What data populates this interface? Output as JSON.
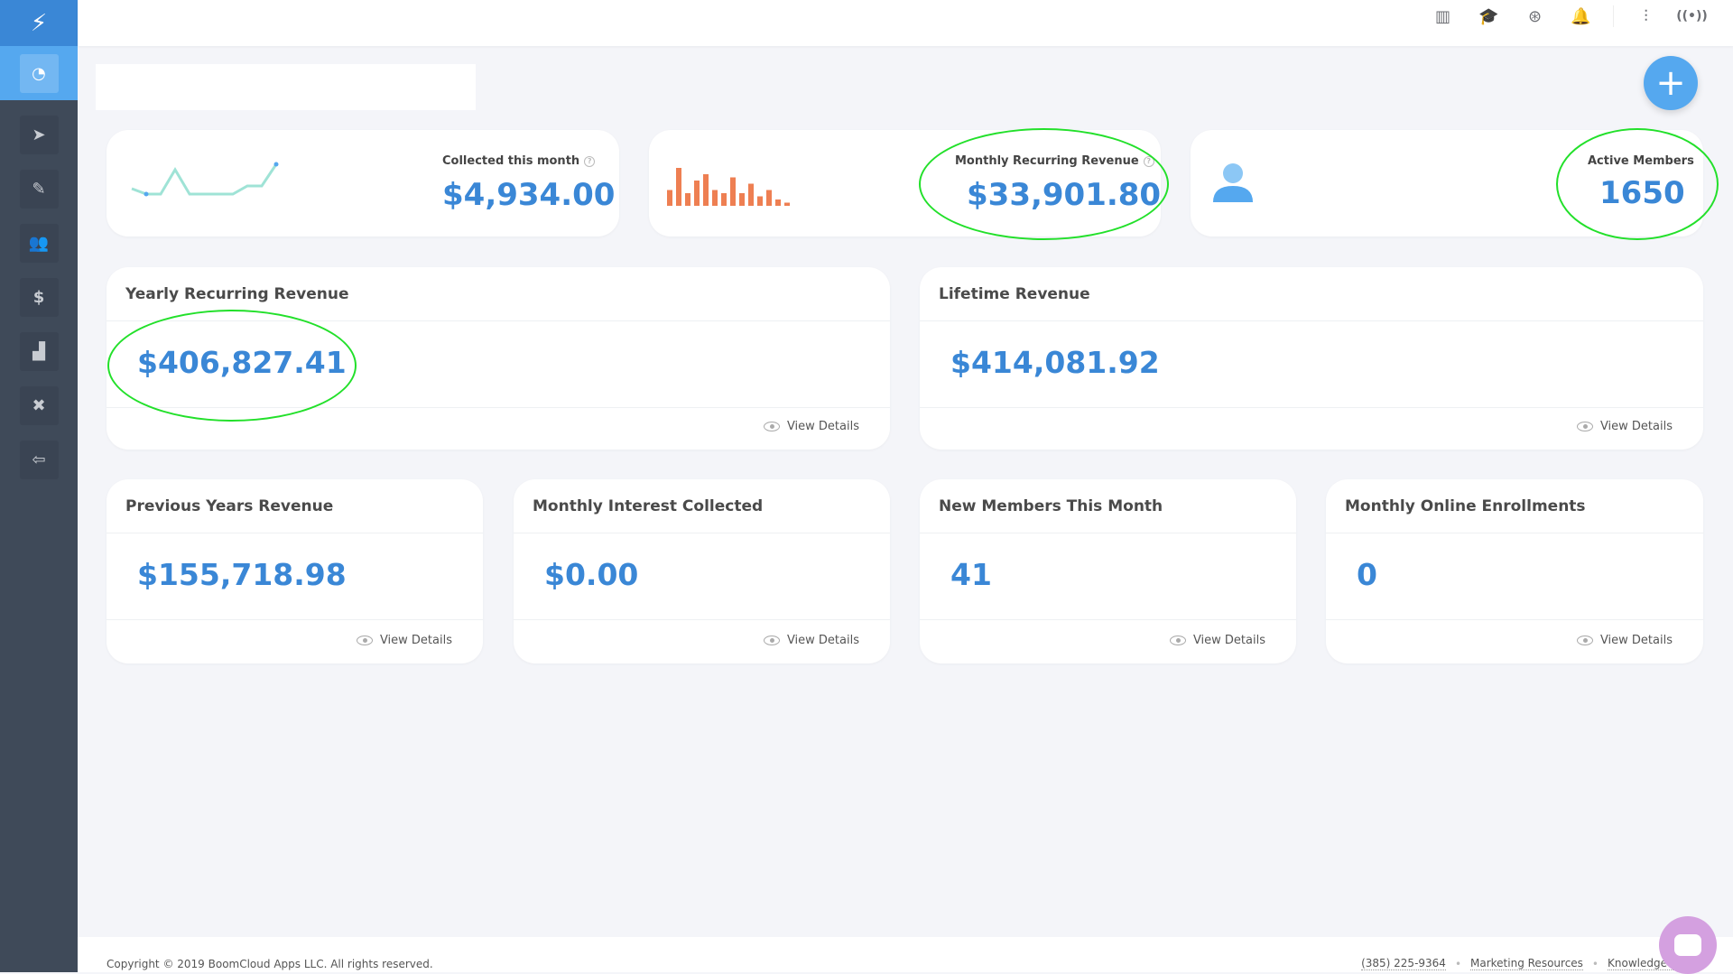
{
  "sidebar": {
    "logo": "bolt-icon",
    "items": [
      {
        "icon": "dashboard-icon",
        "active": true
      },
      {
        "icon": "navigation-icon"
      },
      {
        "icon": "check-sign-icon"
      },
      {
        "icon": "members-icon"
      },
      {
        "icon": "dollar-icon"
      },
      {
        "icon": "chart-icon"
      },
      {
        "icon": "tools-icon"
      },
      {
        "icon": "logout-icon"
      }
    ]
  },
  "topbar": {
    "icons": [
      "library-icon",
      "graduation-cap-icon",
      "lifebuoy-icon",
      "bell-icon",
      "sliders-icon",
      "broadcast-icon"
    ]
  },
  "search": {
    "value": ""
  },
  "fab": {
    "label": "+"
  },
  "kpis": {
    "collected": {
      "label": "Collected this month",
      "value": "$4,934.00"
    },
    "mrr": {
      "label": "Monthly Recurring Revenue",
      "value": "$33,901.80"
    },
    "members": {
      "label": "Active Members",
      "value": "1650"
    }
  },
  "cards": [
    {
      "title": "Yearly Recurring Revenue",
      "value": "$406,827.41",
      "link": "View Details"
    },
    {
      "title": "Lifetime Revenue",
      "value": "$414,081.92",
      "link": "View Details"
    },
    {
      "title": "Previous Years Revenue",
      "value": "$155,718.98",
      "link": "View Details"
    },
    {
      "title": "Monthly Interest Collected",
      "value": "$0.00",
      "link": "View Details"
    },
    {
      "title": "New Members This Month",
      "value": "41",
      "link": "View Details"
    },
    {
      "title": "Monthly Online Enrollments",
      "value": "0",
      "link": "View Details"
    }
  ],
  "sparkline": [
    5,
    3,
    3,
    12,
    3,
    3,
    3,
    3,
    6,
    6,
    14
  ],
  "bars": [
    5,
    12,
    4,
    8,
    10,
    5,
    4,
    9,
    4,
    7,
    3,
    5,
    2,
    1
  ],
  "colors": {
    "accent": "#3a87d6",
    "sidebar": "#3f4a59",
    "sparkline": "#9fe3d6",
    "bars": "#ee7f52",
    "highlight": "#22e02a"
  },
  "footer": {
    "copyright": "Copyright © 2019 BoomCloud Apps LLC. All rights reserved.",
    "links": [
      "(385) 225-9364",
      "Marketing Resources",
      "Knowledge Base"
    ]
  }
}
